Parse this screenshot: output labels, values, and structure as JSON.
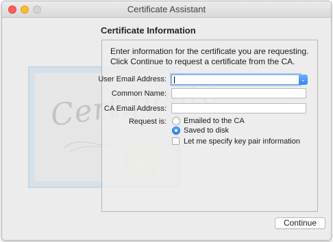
{
  "window": {
    "title": "Certificate Assistant"
  },
  "page": {
    "heading": "Certificate Information",
    "instructions": "Enter information for the certificate you are requesting. Click Continue to request a certificate from the CA."
  },
  "form": {
    "user_email": {
      "label": "User Email Address:",
      "value": ""
    },
    "common_name": {
      "label": "Common Name:",
      "value": ""
    },
    "ca_email": {
      "label": "CA Email Address:",
      "value": ""
    },
    "request": {
      "label": "Request is:",
      "options": [
        {
          "label": "Emailed to the CA",
          "selected": false
        },
        {
          "label": "Saved to disk",
          "selected": true
        }
      ]
    },
    "key_pair_checkbox": {
      "label": "Let me specify key pair information",
      "checked": false
    }
  },
  "buttons": {
    "continue_label": "Continue"
  },
  "colors": {
    "accent": "#2f85f6",
    "close": "#fc5f57",
    "minimize": "#fdbc2e"
  }
}
